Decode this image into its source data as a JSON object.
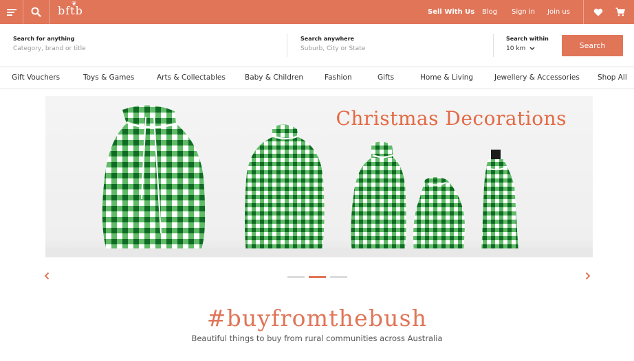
{
  "topbar": {
    "brand": "bftb",
    "sell_label": "Sell With Us",
    "blog_label": "Blog",
    "signin_label": "Sign in",
    "join_label": "Join us",
    "bg_color": "#e07558"
  },
  "search": {
    "anything_label": "Search for anything",
    "anything_placeholder": "Category, brand or title",
    "anywhere_label": "Search anywhere",
    "anywhere_placeholder": "Suburb, City or State",
    "within_label": "Search within",
    "within_value": "10 km",
    "button_label": "Search"
  },
  "categories": [
    "Gift Vouchers",
    "Toys & Games",
    "Arts & Collectables",
    "Baby & Children",
    "Fashion",
    "Gifts",
    "Home & Living",
    "Jewellery & Accessories",
    "Shop All"
  ],
  "hero": {
    "title": "Christmas Decorations",
    "slide_count": 3,
    "active_slide": 2,
    "accent_color": "#e36a45"
  },
  "promo": {
    "hashtag": "#buyfromthebush",
    "tagline": "Beautiful things to buy from rural communities across Australia"
  }
}
